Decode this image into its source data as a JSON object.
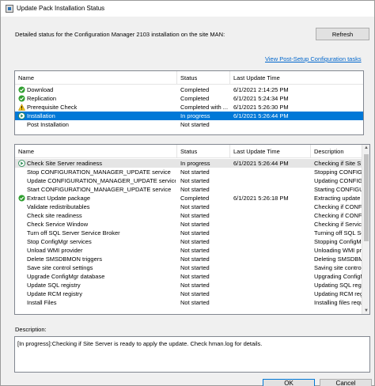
{
  "window": {
    "title": "Update Pack Installation Status"
  },
  "header": {
    "detail_text": "Detailed status for the Configuration Manager 2103 installation on the site MAN:",
    "refresh_label": "Refresh",
    "link_text": "View Post-Setup Configuration tasks"
  },
  "stages": {
    "columns": [
      "Name",
      "Status",
      "Last Update Time"
    ],
    "rows": [
      {
        "icon": "check-icon",
        "name": "Download",
        "status": "Completed",
        "time": "6/1/2021 2:14:25 PM",
        "selected": false
      },
      {
        "icon": "check-icon",
        "name": "Replication",
        "status": "Completed",
        "time": "6/1/2021 5:24:34 PM",
        "selected": false
      },
      {
        "icon": "warning-icon",
        "name": "Prerequisite Check",
        "status": "Completed with ...",
        "time": "6/1/2021 5:26:30 PM",
        "selected": false
      },
      {
        "icon": "progress-icon",
        "name": "Installation",
        "status": "In progress",
        "time": "6/1/2021 5:26:44 PM",
        "selected": true
      },
      {
        "icon": "",
        "name": "Post Installation",
        "status": "Not started",
        "time": "",
        "selected": false
      }
    ]
  },
  "steps": {
    "columns": [
      "Name",
      "Status",
      "Last Update Time",
      "Description"
    ],
    "rows": [
      {
        "icon": "progress-icon",
        "name": "Check Site Server readiness",
        "status": "In progress",
        "time": "6/1/2021 5:26:44 PM",
        "desc": "Checking if Site S",
        "highlight": true
      },
      {
        "icon": "",
        "name": "Stop CONFIGURATION_MANAGER_UPDATE service",
        "status": "Not started",
        "time": "",
        "desc": "Stopping CONFIG"
      },
      {
        "icon": "",
        "name": "Update CONFIGURATION_MANAGER_UPDATE service",
        "status": "Not started",
        "time": "",
        "desc": "Updating CONFIG"
      },
      {
        "icon": "",
        "name": "Start CONFIGURATION_MANAGER_UPDATE service",
        "status": "Not started",
        "time": "",
        "desc": "Starting CONFIGU"
      },
      {
        "icon": "check-icon",
        "name": "Extract Update package",
        "status": "Completed",
        "time": "6/1/2021 5:26:18 PM",
        "desc": "Extracting update p"
      },
      {
        "icon": "",
        "name": "Validate redistributables",
        "status": "Not started",
        "time": "",
        "desc": "Checking if CONFI"
      },
      {
        "icon": "",
        "name": "Check site readiness",
        "status": "Not started",
        "time": "",
        "desc": "Checking if CONFI"
      },
      {
        "icon": "",
        "name": "Check Service Window",
        "status": "Not started",
        "time": "",
        "desc": "Checking if Service"
      },
      {
        "icon": "",
        "name": "Turn off SQL Server Service Broker",
        "status": "Not started",
        "time": "",
        "desc": "Turning off SQL Se"
      },
      {
        "icon": "",
        "name": "Stop ConfigMgr services",
        "status": "Not started",
        "time": "",
        "desc": "Stopping ConfigMg"
      },
      {
        "icon": "",
        "name": "Unload WMI provider",
        "status": "Not started",
        "time": "",
        "desc": "Unloading WMI pro"
      },
      {
        "icon": "",
        "name": "Delete SMSDBMON triggers",
        "status": "Not started",
        "time": "",
        "desc": "Deleting SMSDBM"
      },
      {
        "icon": "",
        "name": "Save site control settings",
        "status": "Not started",
        "time": "",
        "desc": "Saving site contro"
      },
      {
        "icon": "",
        "name": "Upgrade ConfigMgr database",
        "status": "Not started",
        "time": "",
        "desc": "Upgrading ConfigM"
      },
      {
        "icon": "",
        "name": "Update SQL registry",
        "status": "Not started",
        "time": "",
        "desc": "Updating SQL regi"
      },
      {
        "icon": "",
        "name": "Update RCM registry",
        "status": "Not started",
        "time": "",
        "desc": "Updating RCM regi"
      },
      {
        "icon": "",
        "name": "Install Files",
        "status": "Not started",
        "time": "",
        "desc": "Installing files requ"
      }
    ]
  },
  "description": {
    "label": "Description:",
    "text": "[In progress]:Checking if Site Server is ready to apply the update. Check hman.log for details."
  },
  "buttons": {
    "ok": "OK",
    "cancel": "Cancel"
  },
  "colors": {
    "selection": "#0078d7",
    "link": "#0066cc",
    "check": "#2e9e2e",
    "warning": "#f2c318",
    "progress": "#2e8b57"
  }
}
